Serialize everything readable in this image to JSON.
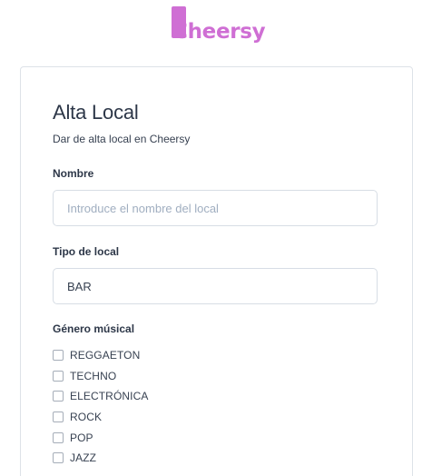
{
  "brand": {
    "name": "Cheersy",
    "color": "#cf6fd4"
  },
  "form": {
    "title": "Alta Local",
    "subtitle": "Dar de alta local en Cheersy",
    "name_label": "Nombre",
    "name_placeholder": "Introduce el nombre del local",
    "name_value": "",
    "type_label": "Tipo de local",
    "type_value": "BAR",
    "genre_label": "Género músical",
    "genres": [
      {
        "label": "REGGAETON",
        "checked": false
      },
      {
        "label": "TECHNO",
        "checked": false
      },
      {
        "label": "ELECTRÓNICA",
        "checked": false
      },
      {
        "label": "ROCK",
        "checked": false
      },
      {
        "label": "POP",
        "checked": false
      },
      {
        "label": "JAZZ",
        "checked": false
      }
    ]
  }
}
